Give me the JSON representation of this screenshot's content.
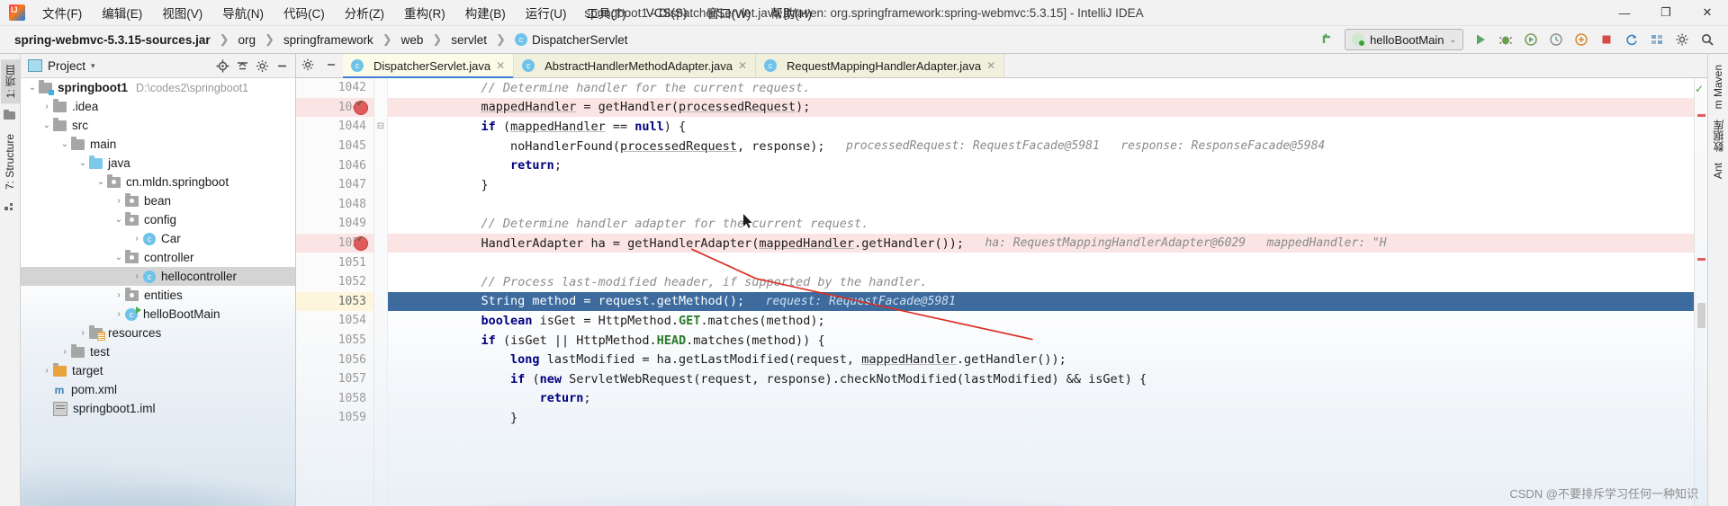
{
  "window": {
    "title": "springboot1 - DispatcherServlet.java [Maven: org.springframework:spring-webmvc:5.3.15] - IntelliJ IDEA",
    "minimize": "—",
    "maximize": "❐",
    "close": "✕"
  },
  "menubar": {
    "items": [
      {
        "label": "文件(F)"
      },
      {
        "label": "编辑(E)"
      },
      {
        "label": "视图(V)"
      },
      {
        "label": "导航(N)"
      },
      {
        "label": "代码(C)"
      },
      {
        "label": "分析(Z)"
      },
      {
        "label": "重构(R)"
      },
      {
        "label": "构建(B)"
      },
      {
        "label": "运行(U)"
      },
      {
        "label": "工具(T)"
      },
      {
        "label": "VCS(S)"
      },
      {
        "label": "窗口(W)"
      },
      {
        "label": "帮助(H)"
      }
    ]
  },
  "navbar": {
    "crumbs": [
      {
        "label": "spring-webmvc-5.3.15-sources.jar",
        "bold": true,
        "icon": ""
      },
      {
        "label": "org",
        "bold": false,
        "icon": ""
      },
      {
        "label": "springframework",
        "bold": false,
        "icon": ""
      },
      {
        "label": "web",
        "bold": false,
        "icon": ""
      },
      {
        "label": "servlet",
        "bold": false,
        "icon": ""
      },
      {
        "label": "DispatcherServlet",
        "bold": false,
        "icon": "class-icon"
      }
    ],
    "separator": "❯",
    "run_config": {
      "label": "helloBootMain",
      "icon": "spring-boot-icon",
      "caret": "⌄"
    },
    "buttons": [
      {
        "name": "jump-to-source-icon",
        "glyph": "↖"
      },
      {
        "name": "run-icon",
        "glyph": "▶"
      },
      {
        "name": "debug-icon",
        "glyph": "🐞"
      },
      {
        "name": "run-with-coverage-icon",
        "glyph": "▶"
      },
      {
        "name": "profile-icon",
        "glyph": "◷"
      },
      {
        "name": "attach-icon",
        "glyph": "⊕"
      },
      {
        "name": "stop-icon",
        "glyph": "■"
      },
      {
        "name": "update-icon",
        "glyph": "⟳"
      },
      {
        "name": "project-structure-icon",
        "glyph": "▤"
      },
      {
        "name": "settings-icon",
        "glyph": "⚙"
      },
      {
        "name": "search-icon",
        "glyph": "⌕"
      }
    ]
  },
  "left_strip": {
    "tabs": [
      {
        "label": "1: 项目",
        "active": true
      },
      {
        "label": "7: Structure",
        "active": false
      }
    ],
    "bottom_icon": "favorites-icon"
  },
  "right_strip": {
    "tabs": [
      {
        "label": "m Maven"
      },
      {
        "label": "数据库"
      },
      {
        "label": "Ant"
      }
    ]
  },
  "project_panel": {
    "title": "Project",
    "caret": "▾",
    "actions": [
      {
        "name": "locate-icon",
        "glyph": "⊕"
      },
      {
        "name": "collapse-all-icon",
        "glyph": "⇱"
      },
      {
        "name": "settings-icon",
        "glyph": "⚙"
      },
      {
        "name": "hide-icon",
        "glyph": "—"
      }
    ],
    "tree": [
      {
        "indent": 0,
        "arrow": "⌄",
        "icon": "module-folder",
        "label": "springboot1",
        "bold": true,
        "path": "D:\\codes2\\springboot1",
        "selected": false
      },
      {
        "indent": 1,
        "arrow": "›",
        "icon": "folder",
        "label": ".idea",
        "bold": false,
        "path": "",
        "selected": false
      },
      {
        "indent": 1,
        "arrow": "⌄",
        "icon": "folder",
        "label": "src",
        "bold": false,
        "path": "",
        "selected": false
      },
      {
        "indent": 2,
        "arrow": "⌄",
        "icon": "folder",
        "label": "main",
        "bold": false,
        "path": "",
        "selected": false
      },
      {
        "indent": 3,
        "arrow": "⌄",
        "icon": "source-folder",
        "label": "java",
        "bold": false,
        "path": "",
        "selected": false
      },
      {
        "indent": 4,
        "arrow": "⌄",
        "icon": "package",
        "label": "cn.mldn.springboot",
        "bold": false,
        "path": "",
        "selected": false
      },
      {
        "indent": 5,
        "arrow": "›",
        "icon": "package",
        "label": "bean",
        "bold": false,
        "path": "",
        "selected": false
      },
      {
        "indent": 5,
        "arrow": "⌄",
        "icon": "package",
        "label": "config",
        "bold": false,
        "path": "",
        "selected": false
      },
      {
        "indent": 6,
        "arrow": "›",
        "icon": "class",
        "label": "Car",
        "bold": false,
        "path": "",
        "selected": false
      },
      {
        "indent": 5,
        "arrow": "⌄",
        "icon": "package",
        "label": "controller",
        "bold": false,
        "path": "",
        "selected": false
      },
      {
        "indent": 6,
        "arrow": "›",
        "icon": "class",
        "label": "hellocontroller",
        "bold": false,
        "path": "",
        "selected": true
      },
      {
        "indent": 5,
        "arrow": "›",
        "icon": "package",
        "label": "entities",
        "bold": false,
        "path": "",
        "selected": false
      },
      {
        "indent": 5,
        "arrow": "›",
        "icon": "runnable-class",
        "label": "helloBootMain",
        "bold": false,
        "path": "",
        "selected": false
      },
      {
        "indent": 3,
        "arrow": "›",
        "icon": "resource-folder",
        "label": "resources",
        "bold": false,
        "path": "",
        "selected": false
      },
      {
        "indent": 2,
        "arrow": "›",
        "icon": "folder",
        "label": "test",
        "bold": false,
        "path": "",
        "selected": false
      },
      {
        "indent": 1,
        "arrow": "›",
        "icon": "target-folder",
        "label": "target",
        "bold": false,
        "path": "",
        "selected": false
      },
      {
        "indent": 1,
        "arrow": "",
        "icon": "maven-file",
        "label": "pom.xml",
        "bold": false,
        "path": "",
        "selected": false
      },
      {
        "indent": 1,
        "arrow": "",
        "icon": "iml-file",
        "label": "springboot1.iml",
        "bold": false,
        "path": "",
        "selected": false
      }
    ]
  },
  "editor": {
    "gutter_actions": [
      {
        "name": "settings-icon",
        "glyph": "⚙"
      },
      {
        "name": "hide-icon",
        "glyph": "—"
      }
    ],
    "tabs": [
      {
        "label": "DispatcherServlet.java",
        "active": true,
        "close": "✕",
        "icon": "class-icon"
      },
      {
        "label": "AbstractHandlerMethodAdapter.java",
        "active": false,
        "close": "✕",
        "icon": "class-icon"
      },
      {
        "label": "RequestMappingHandlerAdapter.java",
        "active": false,
        "close": "✕",
        "icon": "class-icon"
      }
    ],
    "lines": [
      {
        "num": "1042",
        "state": "partial",
        "breakpoint": false,
        "fold": "",
        "tokens": [
          {
            "t": "\t\t\t// Determine handler for the current request.",
            "c": "cm"
          }
        ],
        "hint": ""
      },
      {
        "num": "1043",
        "state": "bp",
        "breakpoint": true,
        "fold": "",
        "tokens": [
          {
            "t": "\t\t\t",
            "c": ""
          },
          {
            "t": "mappedHandler",
            "c": "fld"
          },
          {
            "t": " = getHandler(",
            "c": ""
          },
          {
            "t": "processedRequest",
            "c": "fld"
          },
          {
            "t": ");",
            "c": ""
          }
        ],
        "hint": ""
      },
      {
        "num": "1044",
        "state": "normal",
        "breakpoint": false,
        "fold": "⊟",
        "tokens": [
          {
            "t": "\t\t\t",
            "c": ""
          },
          {
            "t": "if",
            "c": "kw"
          },
          {
            "t": " (",
            "c": ""
          },
          {
            "t": "mappedHandler",
            "c": "fld"
          },
          {
            "t": " == ",
            "c": ""
          },
          {
            "t": "null",
            "c": "kw"
          },
          {
            "t": ") {",
            "c": ""
          }
        ],
        "hint": ""
      },
      {
        "num": "1045",
        "state": "normal",
        "breakpoint": false,
        "fold": "",
        "tokens": [
          {
            "t": "\t\t\t\tnoHandlerFound(",
            "c": ""
          },
          {
            "t": "processedRequest",
            "c": "fld"
          },
          {
            "t": ", response);",
            "c": ""
          }
        ],
        "hint": "processedRequest: RequestFacade@5981   response: ResponseFacade@5984"
      },
      {
        "num": "1046",
        "state": "normal",
        "breakpoint": false,
        "fold": "",
        "tokens": [
          {
            "t": "\t\t\t\t",
            "c": ""
          },
          {
            "t": "return",
            "c": "kw"
          },
          {
            "t": ";",
            "c": ""
          }
        ],
        "hint": ""
      },
      {
        "num": "1047",
        "state": "normal",
        "breakpoint": false,
        "fold": "",
        "tokens": [
          {
            "t": "\t\t\t}",
            "c": ""
          }
        ],
        "hint": ""
      },
      {
        "num": "1048",
        "state": "normal",
        "breakpoint": false,
        "fold": "",
        "tokens": [
          {
            "t": "",
            "c": ""
          }
        ],
        "hint": ""
      },
      {
        "num": "1049",
        "state": "normal",
        "breakpoint": false,
        "fold": "",
        "tokens": [
          {
            "t": "\t\t\t// Determine handler adapter for the current request.",
            "c": "cm"
          }
        ],
        "hint": ""
      },
      {
        "num": "1050",
        "state": "bp",
        "breakpoint": true,
        "fold": "",
        "tokens": [
          {
            "t": "\t\t\tHandlerAdapter ha = getHandlerAdapter(",
            "c": ""
          },
          {
            "t": "mappedHandler",
            "c": "fld"
          },
          {
            "t": ".getHandler());",
            "c": ""
          }
        ],
        "hint": "ha: RequestMappingHandlerAdapter@6029   mappedHandler: \"H"
      },
      {
        "num": "1051",
        "state": "normal",
        "breakpoint": false,
        "fold": "",
        "tokens": [
          {
            "t": "",
            "c": ""
          }
        ],
        "hint": ""
      },
      {
        "num": "1052",
        "state": "normal",
        "breakpoint": false,
        "fold": "",
        "tokens": [
          {
            "t": "\t\t\t// Process last-modified header, if supported by the handler.",
            "c": "cm"
          }
        ],
        "hint": ""
      },
      {
        "num": "1053",
        "state": "exec",
        "breakpoint": false,
        "fold": "",
        "tokens": [
          {
            "t": "\t\t\tString method = request.getMethod();",
            "c": ""
          }
        ],
        "hint": "request: RequestFacade@5981"
      },
      {
        "num": "1054",
        "state": "normal",
        "breakpoint": false,
        "fold": "",
        "tokens": [
          {
            "t": "\t\t\t",
            "c": ""
          },
          {
            "t": "boolean",
            "c": "kw"
          },
          {
            "t": " isGet = HttpMethod.",
            "c": ""
          },
          {
            "t": "GET",
            "c": "st"
          },
          {
            "t": ".matches(method);",
            "c": ""
          }
        ],
        "hint": ""
      },
      {
        "num": "1055",
        "state": "normal",
        "breakpoint": false,
        "fold": "",
        "tokens": [
          {
            "t": "\t\t\t",
            "c": ""
          },
          {
            "t": "if",
            "c": "kw"
          },
          {
            "t": " (isGet || HttpMethod.",
            "c": ""
          },
          {
            "t": "HEAD",
            "c": "st"
          },
          {
            "t": ".matches(method)) {",
            "c": ""
          }
        ],
        "hint": ""
      },
      {
        "num": "1056",
        "state": "normal",
        "breakpoint": false,
        "fold": "",
        "tokens": [
          {
            "t": "\t\t\t\t",
            "c": ""
          },
          {
            "t": "long",
            "c": "kw"
          },
          {
            "t": " lastModified = ha.getLastModified(request, ",
            "c": ""
          },
          {
            "t": "mappedHandler",
            "c": "fld"
          },
          {
            "t": ".getHandler());",
            "c": ""
          }
        ],
        "hint": ""
      },
      {
        "num": "1057",
        "state": "normal",
        "breakpoint": false,
        "fold": "",
        "tokens": [
          {
            "t": "\t\t\t\t",
            "c": ""
          },
          {
            "t": "if",
            "c": "kw"
          },
          {
            "t": " (",
            "c": ""
          },
          {
            "t": "new",
            "c": "kw"
          },
          {
            "t": " ServletWebRequest(request, response).checkNotModified(lastModified) && isGet) {",
            "c": ""
          }
        ],
        "hint": ""
      },
      {
        "num": "1058",
        "state": "normal",
        "breakpoint": false,
        "fold": "",
        "tokens": [
          {
            "t": "\t\t\t\t\t",
            "c": ""
          },
          {
            "t": "return",
            "c": "kw"
          },
          {
            "t": ";",
            "c": ""
          }
        ],
        "hint": ""
      },
      {
        "num": "1059",
        "state": "normal",
        "breakpoint": false,
        "fold": "",
        "tokens": [
          {
            "t": "\t\t\t\t}",
            "c": ""
          }
        ],
        "hint": ""
      }
    ],
    "inspection_ok": "✓"
  },
  "watermark": "CSDN @不要排斥学习任何一种知识",
  "colors": {
    "accent": "#3d6b9e",
    "breakpoint": "#e05b5b",
    "breakpoint_line": "#fbe4e4",
    "current_line": "#fdf6dd",
    "selection": "#d4d4d4",
    "keyword": "#000080",
    "comment": "#8c8c8c",
    "static_field": "#2a7a2a",
    "hint": "#8a8a8a",
    "class_icon": "#6fc3e8",
    "tab_active": "#fbfbe8",
    "run_green": "#4caf50"
  }
}
